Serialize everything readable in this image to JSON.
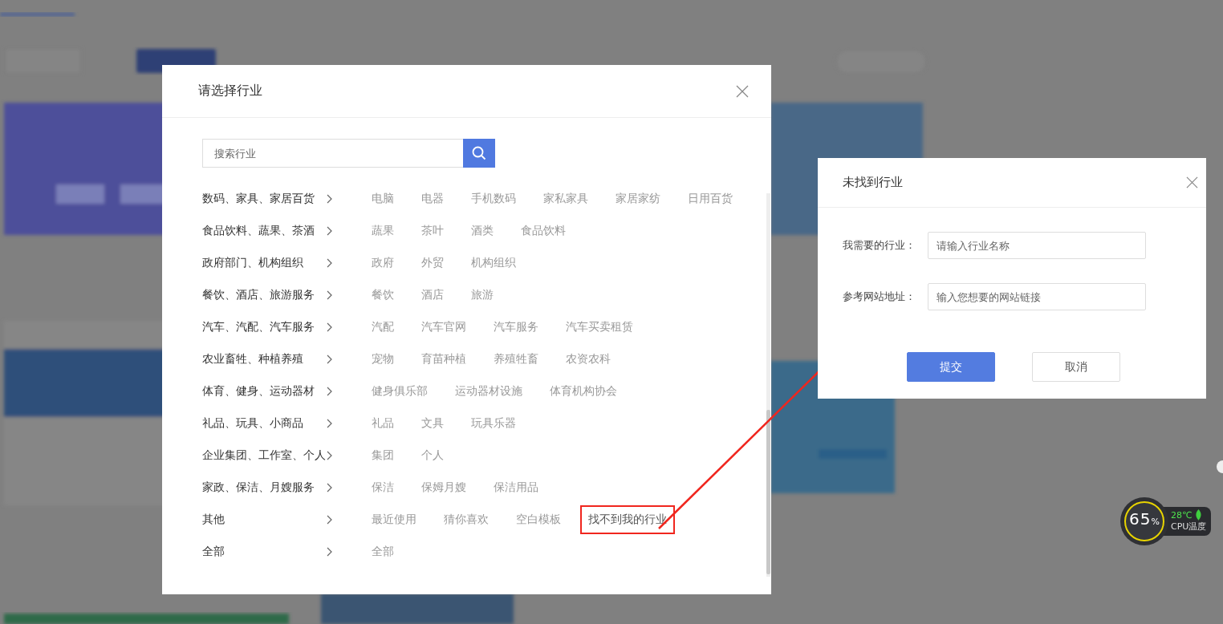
{
  "modal": {
    "title": "请选择行业",
    "search": {
      "placeholder": "搜索行业"
    },
    "categories": [
      {
        "name": "数码、家具、家居百货",
        "items": [
          {
            "label": "电脑",
            "highlighted": false
          },
          {
            "label": "电器",
            "highlighted": false
          },
          {
            "label": "手机数码",
            "highlighted": false
          },
          {
            "label": "家私家具",
            "highlighted": false
          },
          {
            "label": "家居家纺",
            "highlighted": false
          },
          {
            "label": "日用百货",
            "highlighted": false
          }
        ]
      },
      {
        "name": "食品饮料、蔬果、茶酒",
        "items": [
          {
            "label": "蔬果",
            "highlighted": false
          },
          {
            "label": "茶叶",
            "highlighted": false
          },
          {
            "label": "酒类",
            "highlighted": false
          },
          {
            "label": "食品饮料",
            "highlighted": false
          }
        ]
      },
      {
        "name": "政府部门、机构组织",
        "items": [
          {
            "label": "政府",
            "highlighted": false
          },
          {
            "label": "外贸",
            "highlighted": false
          },
          {
            "label": "机构组织",
            "highlighted": false
          }
        ]
      },
      {
        "name": "餐饮、酒店、旅游服务",
        "items": [
          {
            "label": "餐饮",
            "highlighted": false
          },
          {
            "label": "酒店",
            "highlighted": false
          },
          {
            "label": "旅游",
            "highlighted": false
          }
        ]
      },
      {
        "name": "汽车、汽配、汽车服务",
        "items": [
          {
            "label": "汽配",
            "highlighted": false
          },
          {
            "label": "汽车官网",
            "highlighted": false
          },
          {
            "label": "汽车服务",
            "highlighted": false
          },
          {
            "label": "汽车买卖租赁",
            "highlighted": false
          }
        ]
      },
      {
        "name": "农业畜牲、种植养殖",
        "items": [
          {
            "label": "宠物",
            "highlighted": false
          },
          {
            "label": "育苗种植",
            "highlighted": false
          },
          {
            "label": "养殖牲畜",
            "highlighted": false
          },
          {
            "label": "农资农科",
            "highlighted": false
          }
        ]
      },
      {
        "name": "体育、健身、运动器材",
        "items": [
          {
            "label": "健身俱乐部",
            "highlighted": false
          },
          {
            "label": "运动器材设施",
            "highlighted": false
          },
          {
            "label": "体育机构协会",
            "highlighted": false
          }
        ]
      },
      {
        "name": "礼品、玩具、小商品",
        "items": [
          {
            "label": "礼品",
            "highlighted": false
          },
          {
            "label": "文具",
            "highlighted": false
          },
          {
            "label": "玩具乐器",
            "highlighted": false
          }
        ]
      },
      {
        "name": "企业集团、工作室、个人",
        "items": [
          {
            "label": "集团",
            "highlighted": false
          },
          {
            "label": "个人",
            "highlighted": false
          }
        ]
      },
      {
        "name": "家政、保洁、月嫂服务",
        "items": [
          {
            "label": "保洁",
            "highlighted": false
          },
          {
            "label": "保姆月嫂",
            "highlighted": false
          },
          {
            "label": "保洁用品",
            "highlighted": false
          }
        ]
      },
      {
        "name": "其他",
        "items": [
          {
            "label": "最近使用",
            "highlighted": false
          },
          {
            "label": "猜你喜欢",
            "highlighted": false
          },
          {
            "label": "空白模板",
            "highlighted": false
          },
          {
            "label": "找不到我的行业",
            "highlighted": true
          }
        ]
      },
      {
        "name": "全部",
        "items": [
          {
            "label": "全部",
            "highlighted": false
          }
        ]
      }
    ]
  },
  "dialog": {
    "title": "未找到行业",
    "fields": [
      {
        "label": "我需要的行业：",
        "placeholder": "请输入行业名称"
      },
      {
        "label": "参考网站地址：",
        "placeholder": "输入您想要的网站链接"
      }
    ],
    "buttons": [
      {
        "label": "提交",
        "kind": "primary"
      },
      {
        "label": "取消",
        "kind": "secondary"
      }
    ]
  },
  "cpu_widget": {
    "usage": "65",
    "unit": "%",
    "temperature": "28℃",
    "caption": "CPU温度"
  }
}
